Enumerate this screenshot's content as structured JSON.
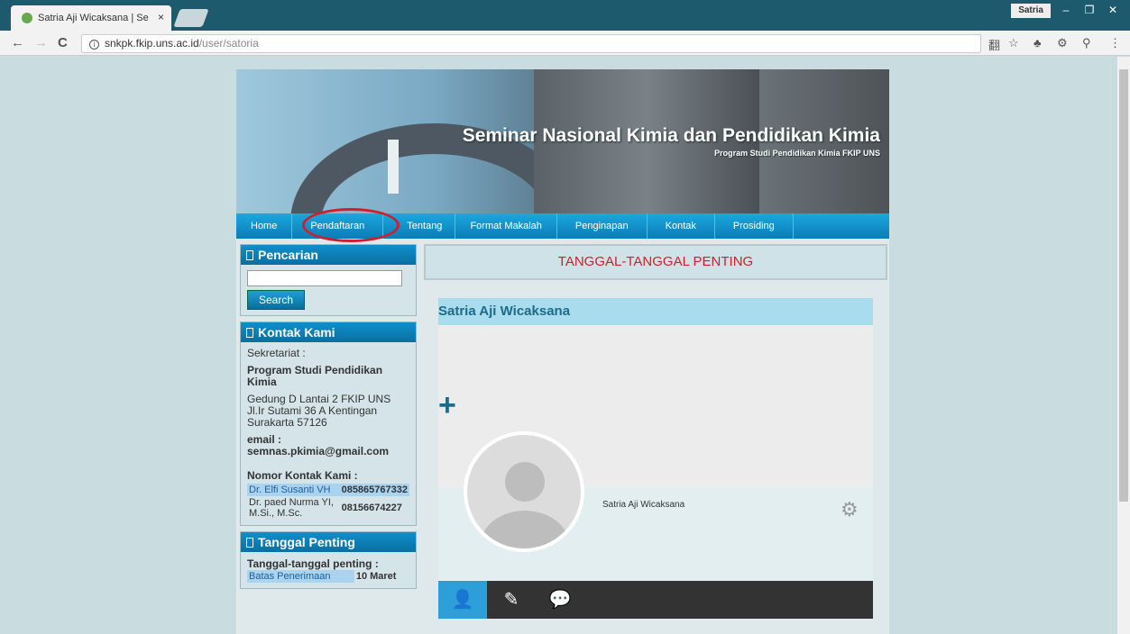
{
  "browser": {
    "tab_title": "Satria Aji Wicaksana | Se",
    "tab_close": "×",
    "user_chip": "Satria",
    "url_host": "snkpk.fkip.uns.ac.id",
    "url_path": "/user/satoria",
    "info_glyph": "i",
    "back": "←",
    "forward": "→",
    "reload": "C",
    "minimize": "–",
    "restore": "❐",
    "close": "✕",
    "ext_translate": "翻",
    "ext_star": "☆",
    "ext_a": "♣",
    "ext_b": "⚙",
    "ext_c": "⚲",
    "ext_menu": "⋮"
  },
  "banner": {
    "title": "Seminar Nasional Kimia dan Pendidikan Kimia",
    "subtitle": "Program Studi Pendidikan Kimia FKIP UNS"
  },
  "menu": [
    "Home",
    "Pendaftaran",
    "Tentang",
    "Format Makalah",
    "Penginapan",
    "Kontak",
    "Prosiding"
  ],
  "search": {
    "heading": "Pencarian",
    "button": "Search"
  },
  "kontak": {
    "heading": "Kontak Kami",
    "sekretariat": "Sekretariat :",
    "org": "Program Studi Pendidikan Kimia",
    "address_1": "Gedung D Lantai 2 FKIP UNS",
    "address_2": "Jl.Ir Sutami 36 A Kentingan",
    "address_3": "Surakarta 57126",
    "email_label": "email :",
    "email": "semnas.pkimia@gmail.com",
    "nomor_label": "Nomor Kontak Kami :",
    "contacts": [
      {
        "name": "Dr. Elfi Susanti VH",
        "phone": "085865767332"
      },
      {
        "name": "Dr. paed Nurma YI, M.Si., M.Sc.",
        "phone": "08156674227"
      }
    ]
  },
  "tanggal": {
    "heading": "Tanggal Penting",
    "label": "Tanggal-tanggal penting :",
    "row_name": "Batas Penerimaan",
    "row_date": "10 Maret"
  },
  "notice": "TANGGAL-TANGGAL PENTING",
  "profile": {
    "name_heading": "Satria Aji Wicaksana",
    "name": "Satria Aji Wicaksana",
    "plus": "+",
    "gear": "⚙",
    "tab_user": "👤",
    "tab_edit": "✎",
    "tab_msg": "💬"
  }
}
